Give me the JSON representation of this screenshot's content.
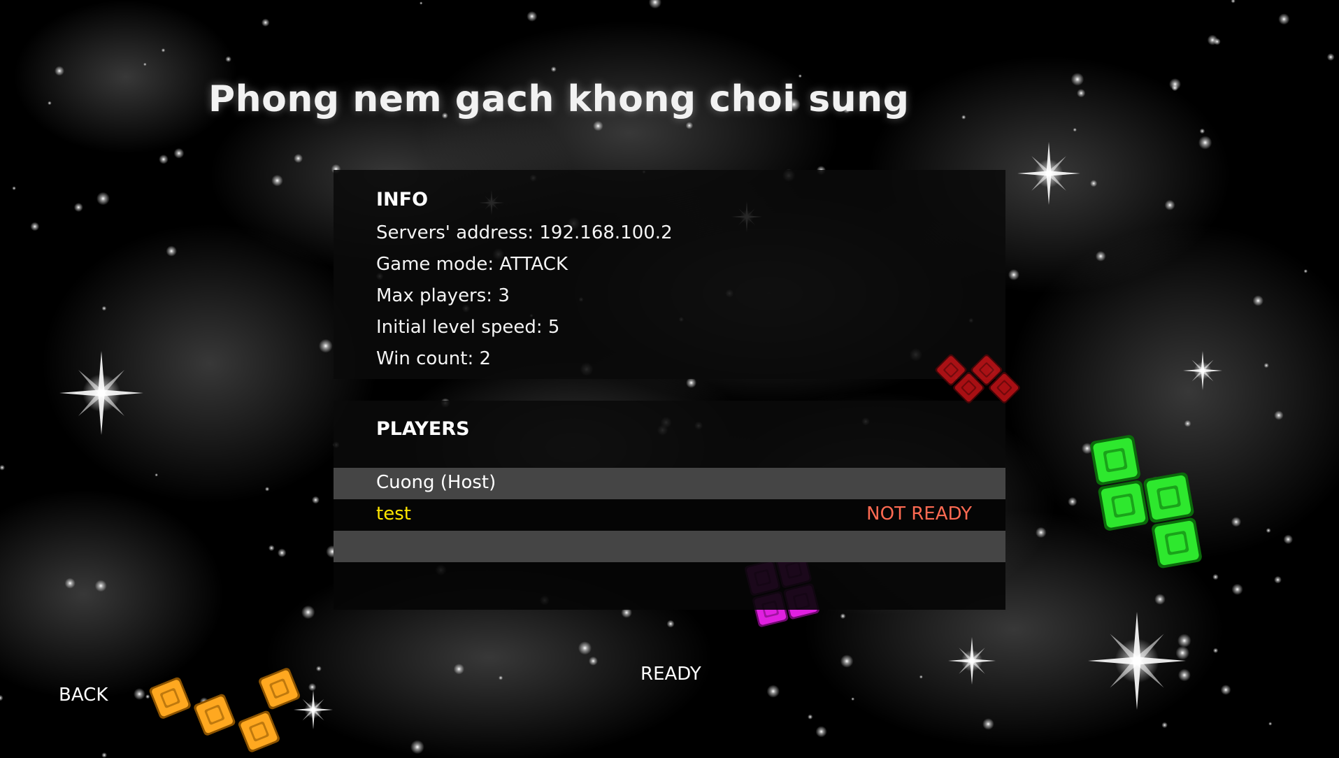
{
  "room": {
    "title": "Phong nem gach khong choi sung"
  },
  "info": {
    "heading": "INFO",
    "server_address": "Servers' address: 192.168.100.2",
    "game_mode": "Game mode: ATTACK",
    "max_players": "Max players: 3",
    "initial_level_speed": "Initial level speed: 5",
    "win_count": "Win count: 2"
  },
  "players": {
    "heading": "PLAYERS",
    "list": [
      {
        "name": "Cuong (Host)",
        "status": "",
        "name_color": "#ffffff",
        "status_color": "#ff6a52"
      },
      {
        "name": "test",
        "status": "NOT READY",
        "name_color": "#ffe600",
        "status_color": "#ff6a52"
      },
      {
        "name": "",
        "status": "",
        "name_color": "#ffffff",
        "status_color": "#ff6a52"
      }
    ]
  },
  "buttons": {
    "back": "BACK",
    "ready": "READY"
  },
  "colors": {
    "background": "#000000",
    "panel": "#0a0a0a",
    "row_light": "#454545",
    "row_dark": "#050505",
    "host_name": "#ffffff",
    "self_name": "#ffe600",
    "not_ready": "#ff6a52",
    "block_red": "#e0141a",
    "block_green": "#2ee82e",
    "block_magenta": "#e020e0",
    "block_orange": "#ffa820"
  }
}
